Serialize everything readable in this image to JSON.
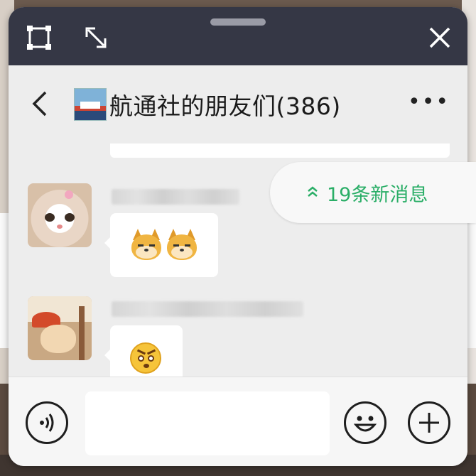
{
  "window": {
    "title": "航通社的朋友们(386)",
    "colors": {
      "topbar": "#353745",
      "background": "#ededed",
      "accent_green": "#2aae67"
    }
  },
  "icons": {
    "window_expand": "expand-frame-icon",
    "window_resize": "resize-diagonal-icon",
    "window_close": "close-icon",
    "back": "chevron-left-icon",
    "more": "more-dots-icon",
    "voice": "voice-icon",
    "emoji": "smiley-icon",
    "plus": "plus-circle-icon"
  },
  "header": {
    "more_label": "•••"
  },
  "new_messages": {
    "label": "19条新消息",
    "chevron": "»"
  },
  "messages": [
    {
      "sender_avatar": "cat-avatar",
      "content": "doge-emoji doge-emoji"
    },
    {
      "sender_avatar": "cartoon-avatar",
      "content": "glare-emoji"
    }
  ],
  "input": {
    "value": "",
    "placeholder": ""
  }
}
